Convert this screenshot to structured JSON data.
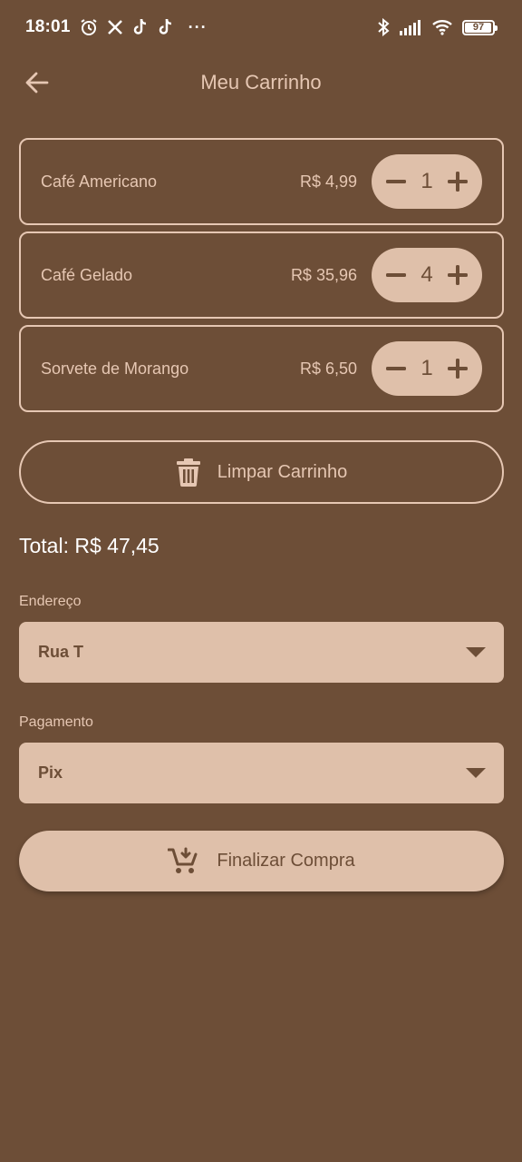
{
  "status_bar": {
    "time": "18:01",
    "notification_icons": [
      "alarm-icon",
      "x-icon",
      "tiktok-icon",
      "tiktok-icon"
    ],
    "more": "···",
    "battery_level": "97",
    "right_icons": [
      "bluetooth-icon",
      "signal-icon",
      "wifi-icon",
      "battery-icon"
    ]
  },
  "header": {
    "title": "Meu Carrinho",
    "back_icon": "arrow-left-icon"
  },
  "cart": {
    "items": [
      {
        "name": "Café Americano",
        "price": "R$ 4,99",
        "quantity": "1"
      },
      {
        "name": "Café Gelado",
        "price": "R$ 35,96",
        "quantity": "4"
      },
      {
        "name": "Sorvete de Morango",
        "price": "R$ 6,50",
        "quantity": "1"
      }
    ],
    "clear_label": "Limpar Carrinho",
    "clear_icon": "trash-icon"
  },
  "total": "Total: R$ 47,45",
  "address": {
    "label": "Endereço",
    "value": "Rua T"
  },
  "payment": {
    "label": "Pagamento",
    "value": "Pix"
  },
  "checkout": {
    "label": "Finalizar Compra",
    "icon": "cart-add-icon"
  },
  "colors": {
    "background": "#6d4e37",
    "accent": "#dfc0aa",
    "text_light": "#e6c7b3"
  }
}
